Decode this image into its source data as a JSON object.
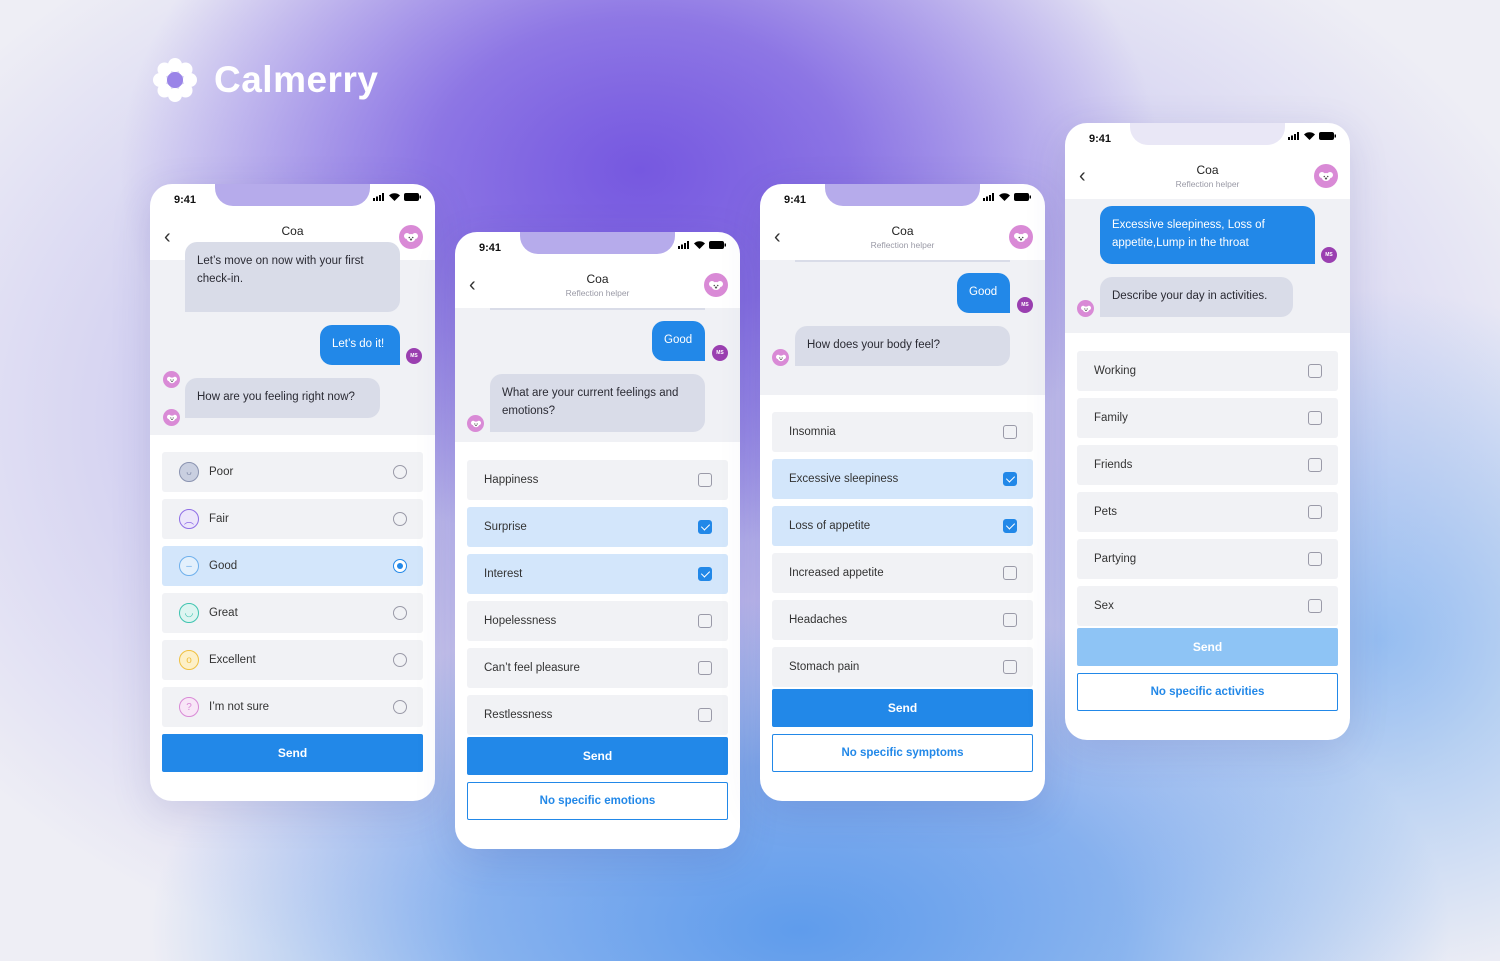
{
  "brand": {
    "name": "Calmerry"
  },
  "colors": {
    "accent": "#2288e8",
    "bot_bubble": "#d9dce8",
    "selected_row": "#d3e6fb",
    "avatar": "#d98ad6",
    "user_avatar": "#9a3fb0"
  },
  "phones": [
    {
      "time": "9:41",
      "title": "Coa",
      "subtitle": "Reflection helper",
      "messages": [
        {
          "from": "bot",
          "text": "Let’s move on now with your first check-in."
        },
        {
          "from": "user",
          "text": "Let’s do it!",
          "avatar": "MS"
        },
        {
          "from": "bot",
          "text": "How are you feeling right now?"
        }
      ],
      "control": "radio",
      "options": [
        {
          "label": "Poor",
          "icon": "sad-face-icon",
          "selected": false
        },
        {
          "label": "Fair",
          "icon": "frown-face-icon",
          "selected": false
        },
        {
          "label": "Good",
          "icon": "neutral-face-icon",
          "selected": true
        },
        {
          "label": "Great",
          "icon": "smile-face-icon",
          "selected": false
        },
        {
          "label": "Excellent",
          "icon": "happy-face-icon",
          "selected": false
        },
        {
          "label": "I’m not sure",
          "icon": "question-icon",
          "selected": false
        }
      ],
      "send": "Send"
    },
    {
      "time": "9:41",
      "title": "Coa",
      "subtitle": "Reflection helper",
      "messages": [
        {
          "from": "user",
          "text": "Good",
          "avatar": "MS"
        },
        {
          "from": "bot",
          "text": "What are your current feelings and emotions?"
        }
      ],
      "control": "checkbox",
      "options": [
        {
          "label": "Happiness",
          "selected": false
        },
        {
          "label": "Surprise",
          "selected": true
        },
        {
          "label": "Interest",
          "selected": true
        },
        {
          "label": "Hopelessness",
          "selected": false
        },
        {
          "label": "Can’t feel pleasure",
          "selected": false
        },
        {
          "label": "Restlessness",
          "selected": false
        }
      ],
      "send": "Send",
      "alt": "No specific emotions"
    },
    {
      "time": "9:41",
      "title": "Coa",
      "subtitle": "Reflection helper",
      "messages": [
        {
          "from": "user",
          "text": "Good",
          "avatar": "MS"
        },
        {
          "from": "bot",
          "text": "How does your body feel?"
        }
      ],
      "control": "checkbox",
      "options": [
        {
          "label": "Insomnia",
          "selected": false
        },
        {
          "label": "Excessive sleepiness",
          "selected": true
        },
        {
          "label": "Loss of appetite",
          "selected": true
        },
        {
          "label": "Increased appetite",
          "selected": false
        },
        {
          "label": "Headaches",
          "selected": false
        },
        {
          "label": "Stomach pain",
          "selected": false
        }
      ],
      "send": "Send",
      "alt": "No specific symptoms"
    },
    {
      "time": "9:41",
      "title": "Coa",
      "subtitle": "Reflection helper",
      "messages": [
        {
          "from": "user",
          "text": "Excessive sleepiness, Loss of appetite,Lump in the throat",
          "avatar": "MS"
        },
        {
          "from": "bot",
          "text": "Describe your day in activities."
        }
      ],
      "control": "checkbox",
      "options": [
        {
          "label": "Working",
          "selected": false
        },
        {
          "label": "Family",
          "selected": false
        },
        {
          "label": "Friends",
          "selected": false
        },
        {
          "label": "Pets",
          "selected": false
        },
        {
          "label": "Partying",
          "selected": false
        },
        {
          "label": "Sex",
          "selected": false
        }
      ],
      "send": "Send",
      "send_disabled": true,
      "alt": "No specific activities"
    }
  ]
}
